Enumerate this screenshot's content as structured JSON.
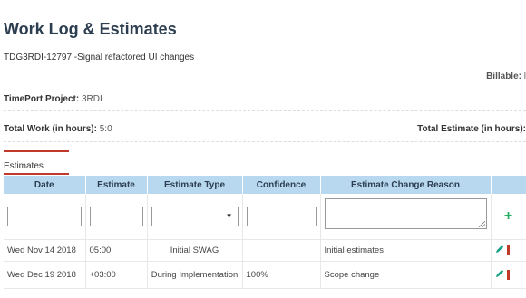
{
  "page": {
    "title": "Work Log & Estimates",
    "subtitle": "TDG3RDI-12797 -Signal refactored UI changes",
    "billable_label": "Billable:",
    "billable_value": "l"
  },
  "fields": {
    "timeport_label": "TimePort Project:",
    "timeport_value": "3RDI",
    "total_work_label": "Total Work (in hours):",
    "total_work_value": "5:0",
    "total_estimate_label": "Total Estimate (in hours):",
    "total_estimate_value": ""
  },
  "estimates": {
    "section_label": "Estimates",
    "columns": [
      "Date",
      "Estimate",
      "Estimate Type",
      "Confidence",
      "Estimate Change Reason",
      ""
    ],
    "new_row": {
      "date": "",
      "estimate": "",
      "estimate_type": "",
      "confidence": "",
      "reason": ""
    },
    "rows": [
      {
        "date": "Wed Nov 14 2018",
        "estimate": "05:00",
        "estimate_type": "Initial SWAG",
        "confidence": "",
        "reason": "Initial estimates"
      },
      {
        "date": "Wed Dec 19 2018",
        "estimate": "+03:00",
        "estimate_type": "During Implementation",
        "confidence": "100%",
        "reason": "Scope change"
      }
    ]
  },
  "icons": {
    "add": "plus-icon",
    "edit": "pencil-icon",
    "delete": "trash-icon",
    "select_caret": "caret-down-icon"
  },
  "colors": {
    "title": "#2c3e50",
    "header_bg": "#b8d8f0",
    "tab_accent": "#c0392b",
    "add_green": "#27ae60",
    "edit_teal": "#16a085",
    "delete_red": "#c0392b"
  }
}
